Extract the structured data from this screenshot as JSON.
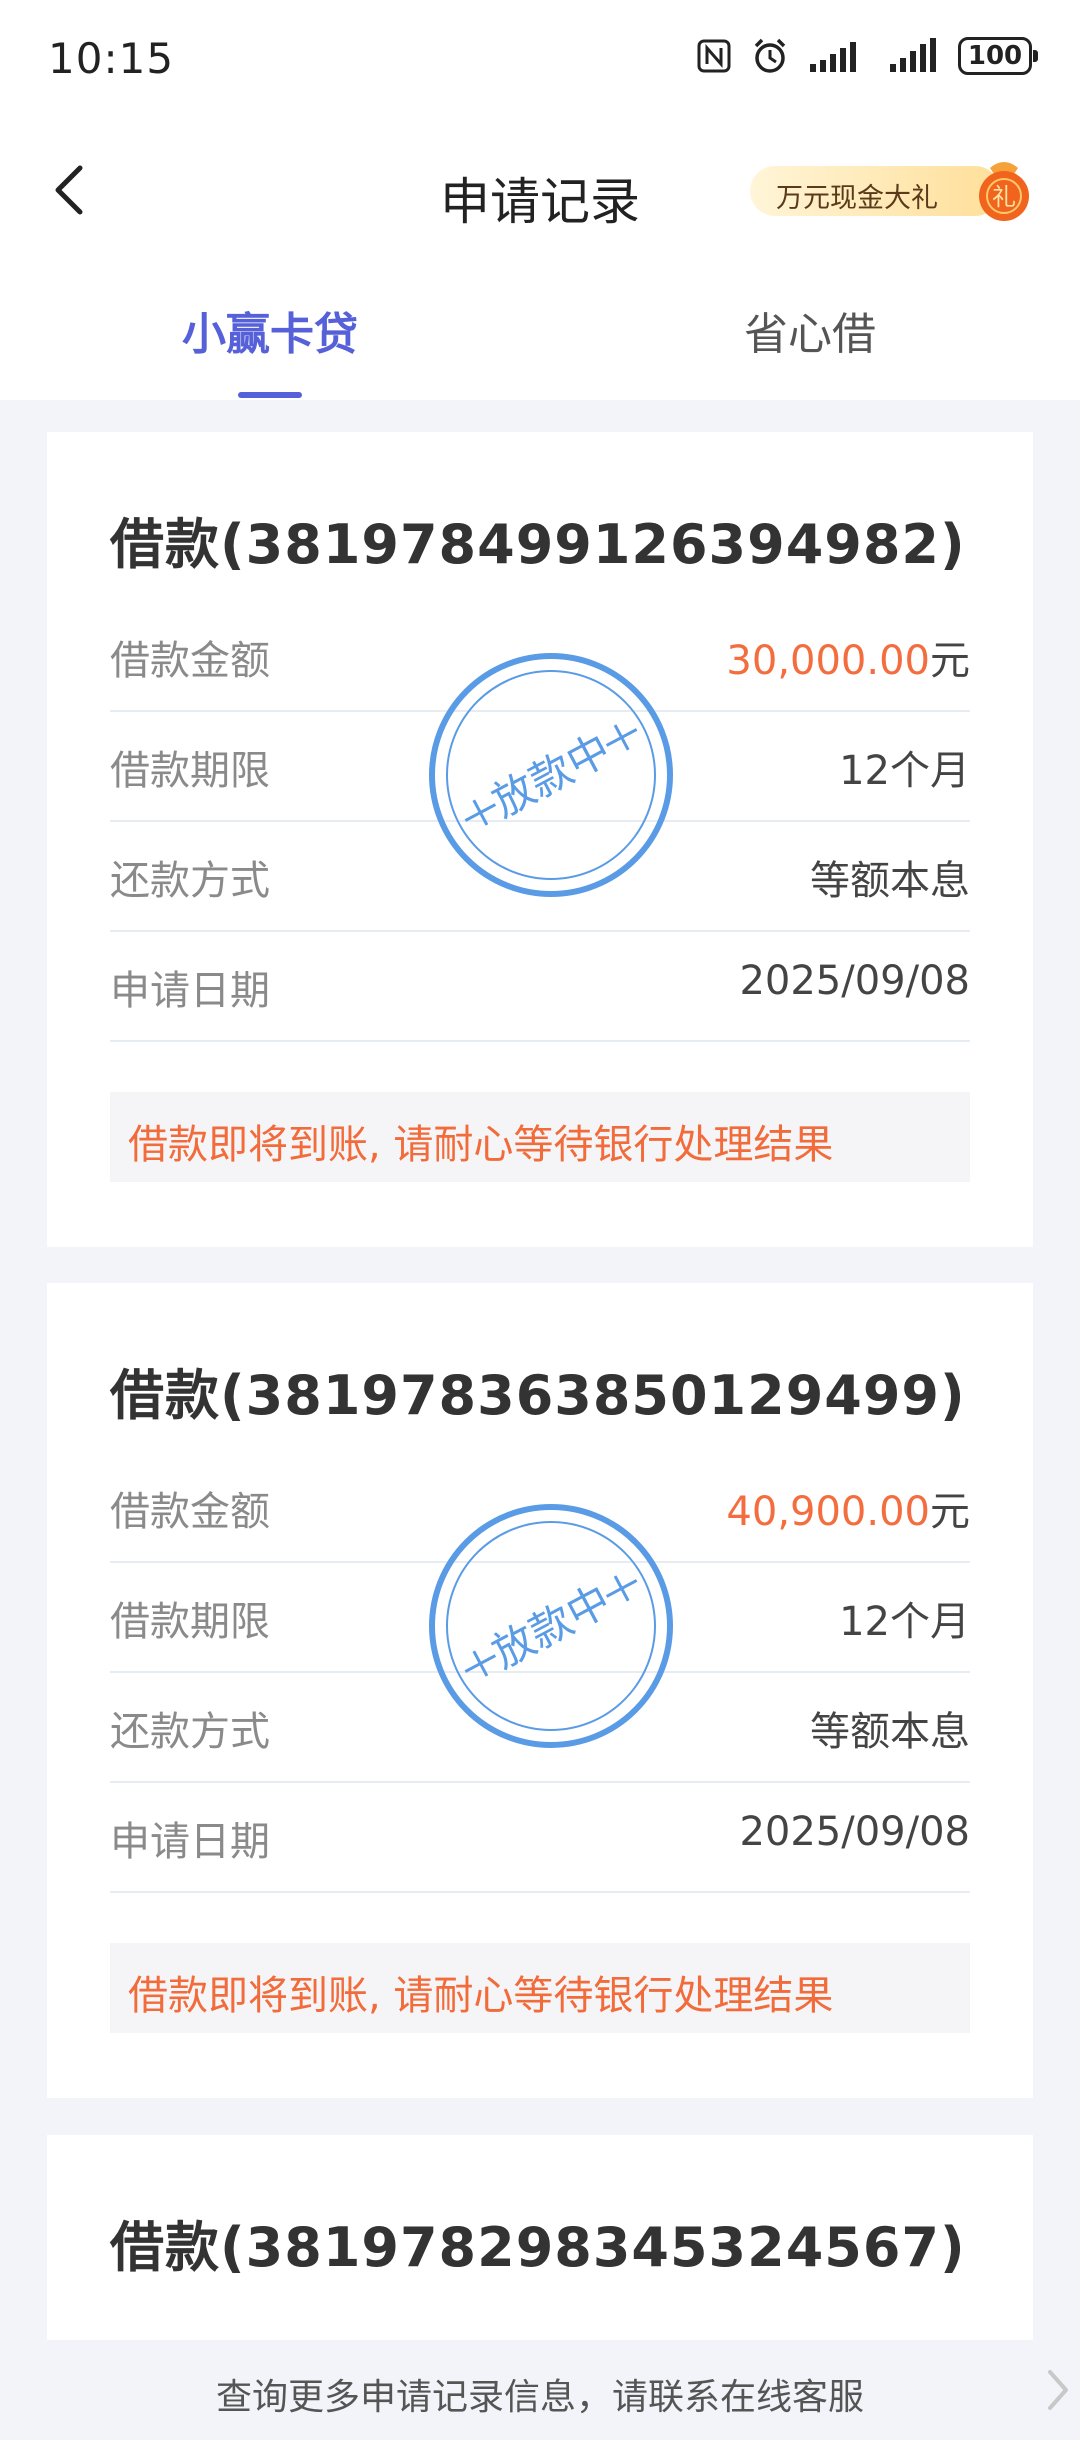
{
  "status_bar": {
    "time": "10:15",
    "battery": "100",
    "icons": [
      "nfc-icon",
      "alarm-icon",
      "signal-icon",
      "signal-icon",
      "battery-icon"
    ]
  },
  "header": {
    "title": "申请记录",
    "promo_label": "万元现金大礼",
    "promo_badge": "礼"
  },
  "tabs": [
    {
      "label": "小赢卡贷",
      "active": true
    },
    {
      "label": "省心借",
      "active": false
    }
  ],
  "labels": {
    "amount": "借款金额",
    "term": "借款期限",
    "repayment": "还款方式",
    "date": "申请日期"
  },
  "records": [
    {
      "title": "借款(381978499126394982)",
      "amount": "30,000.00",
      "currency": "元",
      "term": "12个月",
      "repayment": "等额本息",
      "date": "2025/09/08",
      "stamp": "放款中",
      "notice": "借款即将到账, 请耐心等待银行处理结果"
    },
    {
      "title": "借款(381978363850129499)",
      "amount": "40,900.00",
      "currency": "元",
      "term": "12个月",
      "repayment": "等额本息",
      "date": "2025/09/08",
      "stamp": "放款中",
      "notice": "借款即将到账, 请耐心等待银行处理结果"
    },
    {
      "title": "借款(381978298345324567)"
    }
  ],
  "footer": {
    "text": "查询更多申请记录信息，请联系在线客服"
  },
  "colors": {
    "accent": "#5660d8",
    "amount": "#f36d3e",
    "stamp": "#5a9be6"
  }
}
